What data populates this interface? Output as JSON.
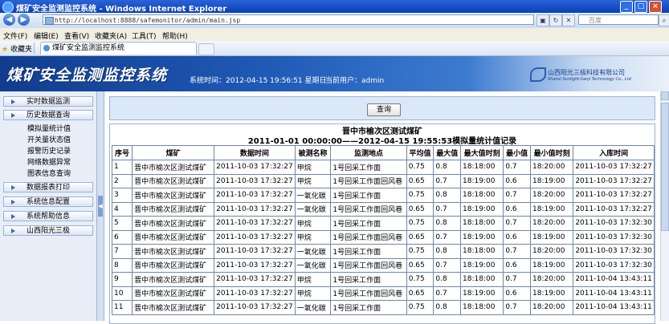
{
  "window": {
    "title": "煤矿安全监测监控系统 - Windows Internet Explorer",
    "minimize": "_",
    "maximize": "□",
    "close": "×"
  },
  "browser": {
    "back": "◀",
    "forward": "▶",
    "address": "http://localhost:8888/safemonitor/admin/main.jsp",
    "search_placeholder": "百度",
    "menu": [
      "文件(F)",
      "编辑(E)",
      "查看(V)",
      "收藏夹(A)",
      "工具(T)",
      "帮助(H)"
    ],
    "favorites_label": "收藏夹",
    "tab_title": "煤矿安全监测监控系统"
  },
  "header": {
    "logo": "煤矿安全监测监控系统",
    "system_time_label": "系统时间：",
    "system_time": "2012-04-15 19:56:51 星期日",
    "current_user_label": "当前用户：",
    "current_user": "admin",
    "company_cn": "山西阳光三极科技有限公司",
    "company_en": "Shanxi Sunlight-Sanji Technology Co., Ltd"
  },
  "sidebar": {
    "items": [
      {
        "label": "实时数据监测"
      },
      {
        "label": "历史数据查询",
        "children": [
          "模拟量统计值",
          "开关量状态值",
          "报警历史记录",
          "网络数据异常",
          "图表信息查询"
        ]
      },
      {
        "label": "数据报表打印"
      },
      {
        "label": "系统信息配置"
      },
      {
        "label": "系统帮助信息"
      },
      {
        "label": "山西阳光三极"
      }
    ],
    "collapse_glyph": "◀"
  },
  "main": {
    "query_button": "查询",
    "report_title": "晋中市榆次区测试煤矿",
    "report_subtitle": "2011-01-01 00:00:00——2012-04-15 19:55:53模拟量统计值记录",
    "columns": [
      "序号",
      "煤矿",
      "数据时间",
      "被测名称",
      "监测地点",
      "平均值",
      "最大值",
      "最大值时刻",
      "最小值",
      "最小值时刻",
      "入库时间"
    ],
    "rows": [
      [
        "1",
        "晋中市榆次区测试煤矿",
        "2011-10-03 17:32:27",
        "甲烷",
        "1号回采工作面",
        "0.75",
        "0.8",
        "18:18:00",
        "0.7",
        "18:20:00",
        "2011-10-03 17:32:27"
      ],
      [
        "2",
        "晋中市榆次区测试煤矿",
        "2011-10-03 17:32:27",
        "甲烷",
        "1号回采工作面回风巷",
        "0.65",
        "0.7",
        "18:19:00",
        "0.6",
        "18:19:00",
        "2011-10-03 17:32:27"
      ],
      [
        "3",
        "晋中市榆次区测试煤矿",
        "2011-10-03 17:32:27",
        "一氧化碳",
        "1号回采工作面",
        "0.75",
        "0.8",
        "18:18:00",
        "0.7",
        "18:20:00",
        "2011-10-03 17:32:27"
      ],
      [
        "4",
        "晋中市榆次区测试煤矿",
        "2011-10-03 17:32:27",
        "一氧化碳",
        "1号回采工作面回风巷",
        "0.65",
        "0.7",
        "18:19:00",
        "0.6",
        "18:19:00",
        "2011-10-03 17:32:27"
      ],
      [
        "5",
        "晋中市榆次区测试煤矿",
        "2011-10-03 17:32:27",
        "甲烷",
        "1号回采工作面",
        "0.75",
        "0.8",
        "18:18:00",
        "0.7",
        "18:20:00",
        "2011-10-03 17:32:30"
      ],
      [
        "6",
        "晋中市榆次区测试煤矿",
        "2011-10-03 17:32:27",
        "甲烷",
        "1号回采工作面回风巷",
        "0.65",
        "0.7",
        "18:19:00",
        "0.6",
        "18:19:00",
        "2011-10-03 17:32:30"
      ],
      [
        "7",
        "晋中市榆次区测试煤矿",
        "2011-10-03 17:32:27",
        "一氧化碳",
        "1号回采工作面",
        "0.75",
        "0.8",
        "18:18:00",
        "0.7",
        "18:20:00",
        "2011-10-03 17:32:30"
      ],
      [
        "8",
        "晋中市榆次区测试煤矿",
        "2011-10-03 17:32:27",
        "一氧化碳",
        "1号回采工作面回风巷",
        "0.65",
        "0.7",
        "18:19:00",
        "0.6",
        "18:19:00",
        "2011-10-03 17:32:30"
      ],
      [
        "9",
        "晋中市榆次区测试煤矿",
        "2011-10-03 17:32:27",
        "甲烷",
        "1号回采工作面",
        "0.75",
        "0.8",
        "18:18:00",
        "0.7",
        "18:20:00",
        "2011-10-04 13:43:11"
      ],
      [
        "10",
        "晋中市榆次区测试煤矿",
        "2011-10-03 17:32:27",
        "甲烷",
        "1号回采工作面回风巷",
        "0.65",
        "0.7",
        "18:19:00",
        "0.6",
        "18:19:00",
        "2011-10-04 13:43:11"
      ],
      [
        "11",
        "晋中市榆次区测试煤矿",
        "2011-10-03 17:32:27",
        "一氧化碳",
        "1号回采工作面",
        "0.75",
        "0.8",
        "18:18:00",
        "0.7",
        "18:20:00",
        "2011-10-04 13:43:11"
      ]
    ]
  }
}
